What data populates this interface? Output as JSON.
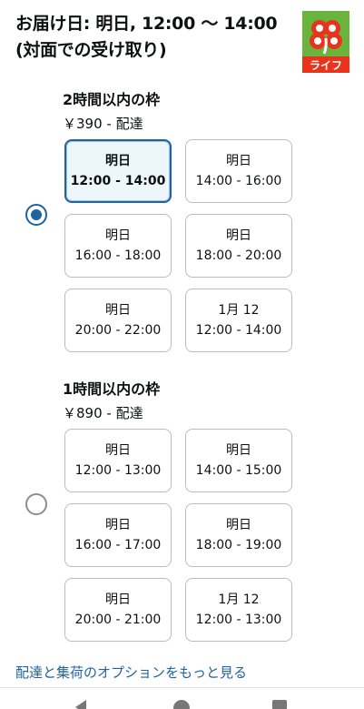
{
  "header": {
    "title": "お届け日: 明日, 12:00 〜 14:00 (対面での受け取り)"
  },
  "logo": {
    "text": "ライフ",
    "brand_color": "#e8341c",
    "leaf_color": "#6ab43e"
  },
  "sections": [
    {
      "title": "2時間以内の枠",
      "price": "￥390 - 配達",
      "selected": true,
      "slots": [
        {
          "day": "明日",
          "time": "12:00 - 14:00",
          "selected": true
        },
        {
          "day": "明日",
          "time": "14:00 - 16:00",
          "selected": false
        },
        {
          "day": "明日",
          "time": "16:00 - 18:00",
          "selected": false
        },
        {
          "day": "明日",
          "time": "18:00 - 20:00",
          "selected": false
        },
        {
          "day": "明日",
          "time": "20:00 - 22:00",
          "selected": false
        },
        {
          "day": "1月 12",
          "time": "12:00 - 14:00",
          "selected": false
        }
      ]
    },
    {
      "title": "1時間以内の枠",
      "price": "￥890 - 配達",
      "selected": false,
      "slots": [
        {
          "day": "明日",
          "time": "12:00 - 13:00",
          "selected": false
        },
        {
          "day": "明日",
          "time": "14:00 - 15:00",
          "selected": false
        },
        {
          "day": "明日",
          "time": "16:00 - 17:00",
          "selected": false
        },
        {
          "day": "明日",
          "time": "18:00 - 19:00",
          "selected": false
        },
        {
          "day": "明日",
          "time": "20:00 - 21:00",
          "selected": false
        },
        {
          "day": "1月 12",
          "time": "12:00 - 13:00",
          "selected": false
        }
      ]
    }
  ],
  "more_link": "配達と集荷のオプションをもっと見る",
  "colors": {
    "accent": "#2162a1",
    "selected_bg": "#edf6fb",
    "border": "#b9bdc1"
  }
}
